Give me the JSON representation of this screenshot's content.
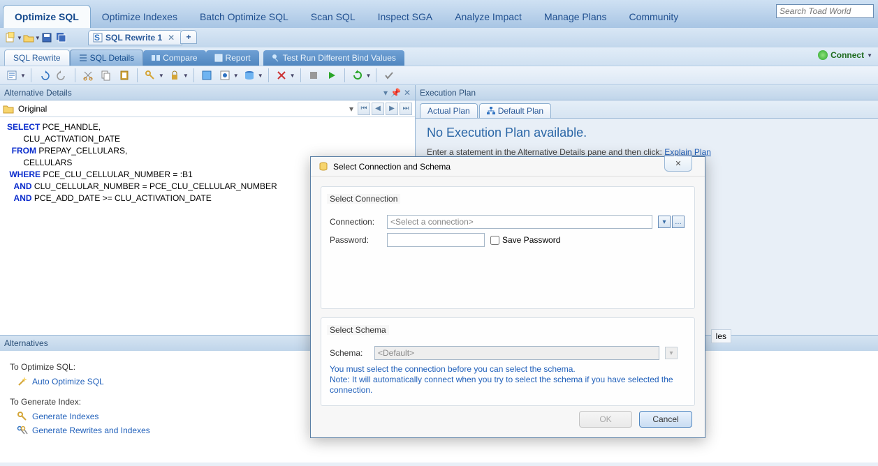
{
  "nav": {
    "tabs": [
      "Optimize SQL",
      "Optimize Indexes",
      "Batch Optimize SQL",
      "Scan SQL",
      "Inspect SGA",
      "Analyze Impact",
      "Manage Plans",
      "Community"
    ],
    "active": 0
  },
  "search": {
    "placeholder": "Search Toad World"
  },
  "docTab": {
    "label": "SQL Rewrite 1"
  },
  "subtabs": {
    "main": "SQL Rewrite",
    "details": "SQL Details",
    "compare": "Compare",
    "report": "Report",
    "testrun": "Test Run Different Bind Values"
  },
  "connect": {
    "label": "Connect"
  },
  "altDetails": {
    "title": "Alternative Details",
    "original": "Original"
  },
  "sql": {
    "lines": [
      {
        "kw": "SELECT",
        "rest": " PCE_HANDLE,"
      },
      {
        "indent": "       ",
        "rest": "CLU_ACTIVATION_DATE"
      },
      {
        "kw": "  FROM",
        "rest": " PREPAY_CELLULARS,"
      },
      {
        "indent": "       ",
        "rest": "CELLULARS"
      },
      {
        "kw": " WHERE",
        "rest": " PCE_CLU_CELLULAR_NUMBER = :B1"
      },
      {
        "kw": "   AND",
        "rest": " CLU_CELLULAR_NUMBER = PCE_CLU_CELLULAR_NUMBER"
      },
      {
        "kw": "   AND",
        "rest": " PCE_ADD_DATE >= CLU_ACTIVATION_DATE"
      }
    ]
  },
  "exec": {
    "title": "Execution Plan",
    "tab_actual": "Actual Plan",
    "tab_default": "Default Plan",
    "heading": "No Execution Plan available.",
    "hint_pre": "Enter a statement in the Alternative Details pane and then click: ",
    "hint_link": "Explain Plan"
  },
  "alternatives": {
    "title": "Alternatives",
    "optimize_title": "To Optimize SQL:",
    "auto_optimize": "Auto Optimize SQL",
    "generate_title": "To Generate Index:",
    "gen_indexes": "Generate Indexes",
    "gen_rewrites": "Generate Rewrites and Indexes"
  },
  "dialog": {
    "title": "Select Connection and Schema",
    "section_conn": "Select Connection",
    "conn_label": "Connection:",
    "conn_placeholder": "<Select a connection>",
    "pwd_label": "Password:",
    "save_pwd": "Save Password",
    "section_schema": "Select Schema",
    "schema_label": "Schema:",
    "schema_placeholder": "<Default>",
    "note1": "You must select the connection before you can select the schema.",
    "note2": "Note: It will automatically connect when you try to select the schema if you have selected the connection.",
    "ok": "OK",
    "cancel": "Cancel"
  },
  "extra_tab": "les"
}
